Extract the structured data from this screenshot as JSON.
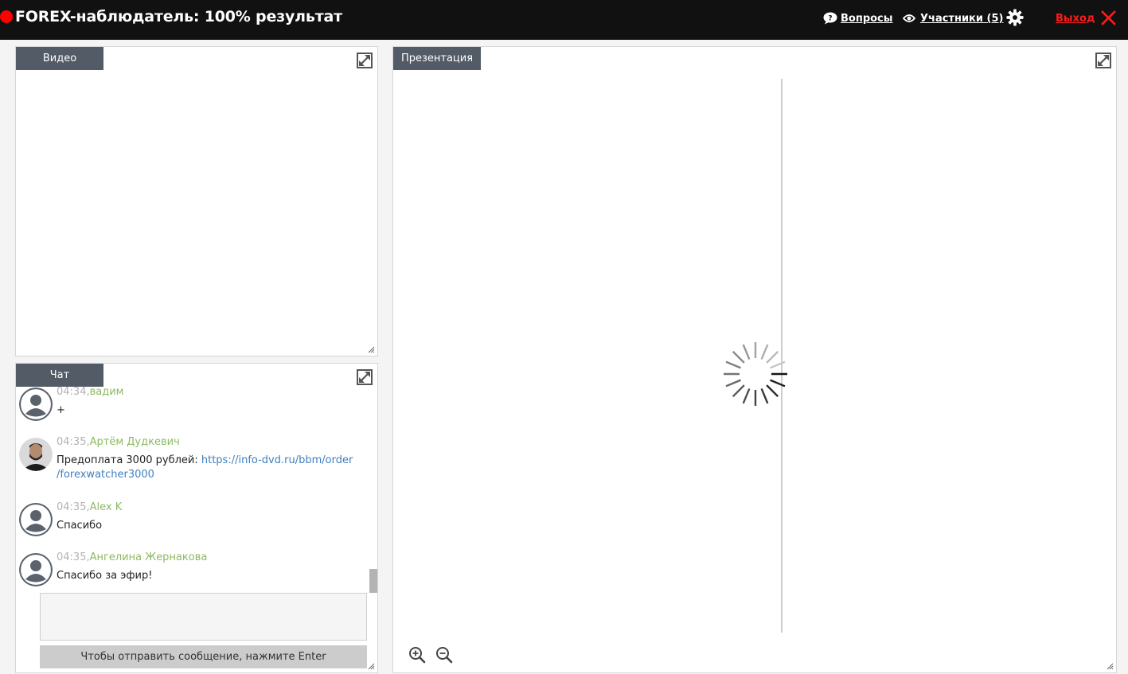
{
  "header": {
    "title": "FOREX-наблюдатель: 100% результат",
    "questions_label": "Вопросы",
    "participants_label": "Участники (5)",
    "exit_label": "Выход"
  },
  "video": {
    "tab_label": "Видео"
  },
  "chat": {
    "tab_label": "Чат",
    "messages": [
      {
        "time": "04:34,",
        "name": "вадим",
        "text": "+",
        "avatar": "default-avatar"
      },
      {
        "time": "04:35,",
        "name": "Артём Дудкевич",
        "text": "Предоплата 3000 рублей: ",
        "link_line1": "https://info-dvd.ru/bbm/order",
        "link_line2": "/forexwatcher3000",
        "avatar": "photo-avatar"
      },
      {
        "time": "04:35,",
        "name": "Alex K",
        "text": "Спасибо",
        "avatar": "default-avatar"
      },
      {
        "time": "04:35,",
        "name": "Ангелина Жернакова",
        "text": "Спасибо за эфир!",
        "avatar": "default-avatar"
      }
    ],
    "input_value": "",
    "send_hint": "Чтобы отправить сообщение, нажмите Enter"
  },
  "presentation": {
    "tab_label": "Презентация"
  },
  "colors": {
    "header_bg": "#111111",
    "live_dot": "#ff0000",
    "exit": "#ff1a1a",
    "tab_bg": "#535b66",
    "chat_name": "#8cba62",
    "chat_time": "#b3b3b3",
    "link": "#3f7fbf"
  },
  "icons": [
    "question-bubble-icon",
    "eye-icon",
    "gear-icon",
    "close-icon",
    "expand-icon",
    "resize-grip-icon",
    "user-icon",
    "zoom-in-icon",
    "zoom-out-icon",
    "loading-spinner-icon"
  ]
}
